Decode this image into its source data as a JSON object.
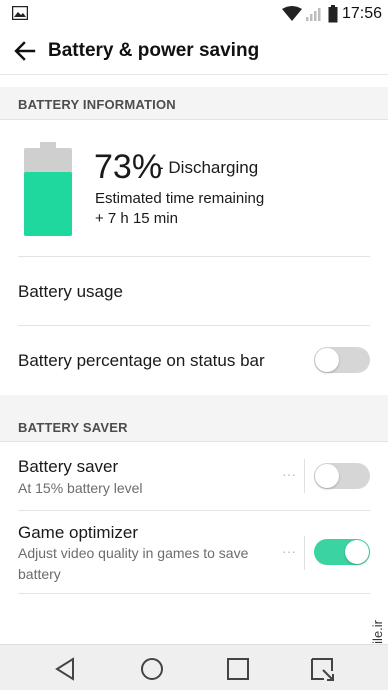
{
  "status_bar": {
    "time": "17:56",
    "left_icon": "image-icon",
    "icons": [
      "wifi-icon",
      "signal-icon",
      "battery-icon"
    ]
  },
  "header": {
    "title": "Battery & power saving",
    "back_icon": "back-arrow-icon"
  },
  "battery_information": {
    "section_label": "BATTERY INFORMATION",
    "percent": "73%",
    "status": "- Discharging",
    "level": 0.73,
    "colors": {
      "fill": "#1ed89d",
      "empty": "#cfcfcf"
    },
    "estimate_label": "Estimated time remaining",
    "estimate_value": "+ 7 h 15 min",
    "usage_label": "Battery usage",
    "percentage_on_status_bar": {
      "label": "Battery percentage on status bar",
      "enabled": false
    }
  },
  "battery_saver_section": {
    "section_label": "BATTERY SAVER",
    "items": [
      {
        "title": "Battery saver",
        "subtitle": "At 15% battery level",
        "enabled": false
      },
      {
        "title": "Game optimizer",
        "subtitle": "Adjust video quality in games to save battery",
        "enabled": true
      }
    ]
  },
  "accent_color": "#3bd3a2",
  "watermark": "mobile.ir",
  "nav_bar": {
    "buttons": [
      "back-triangle-icon",
      "home-circle-icon",
      "recents-square-icon",
      "capture-icon"
    ]
  }
}
